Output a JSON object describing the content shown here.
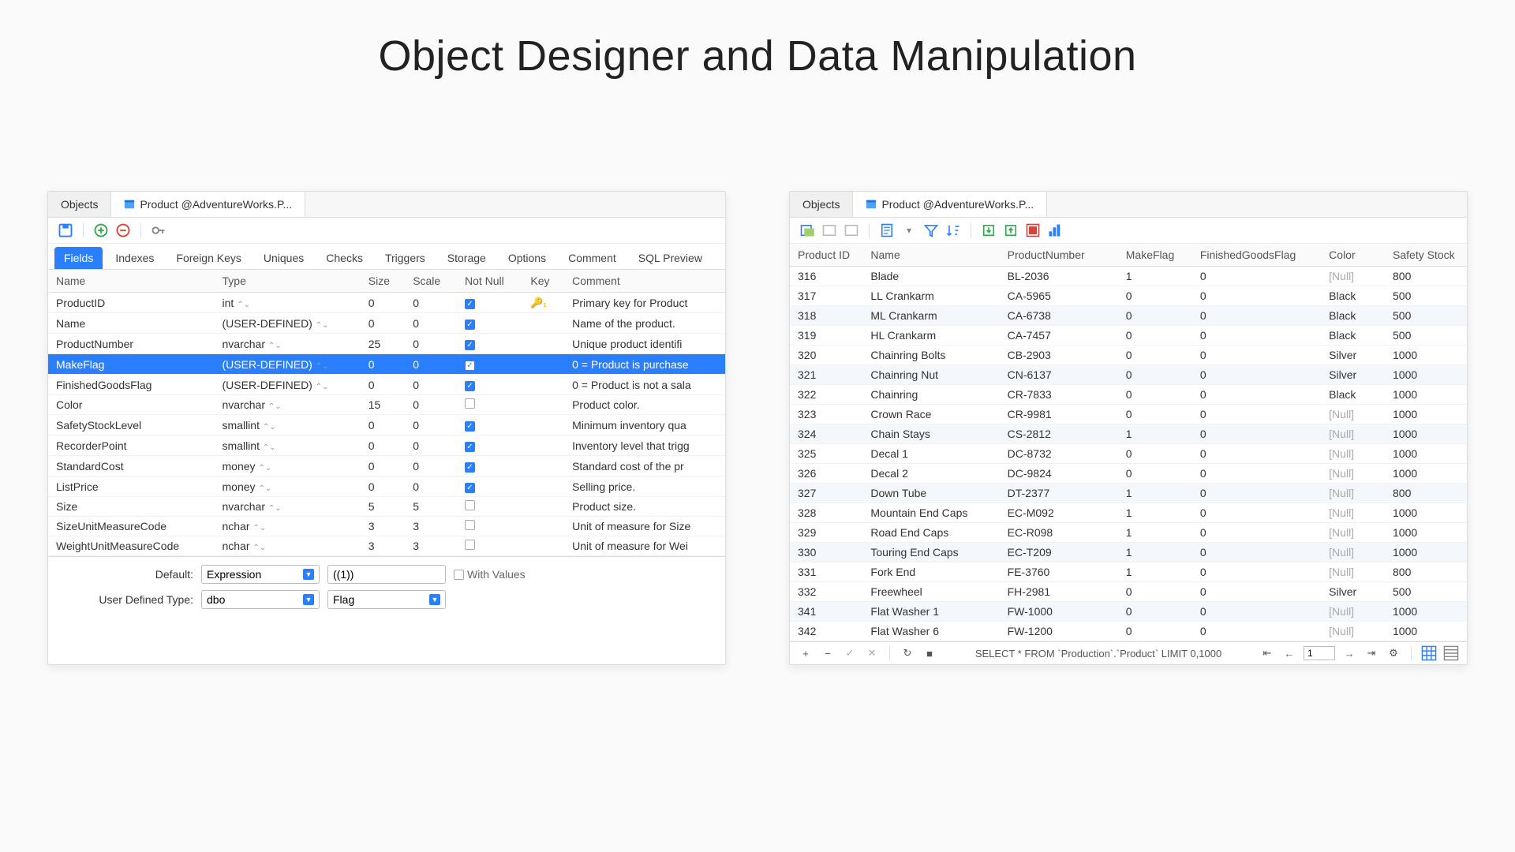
{
  "title": "Object Designer and Data Manipulation",
  "left": {
    "tabs": [
      "Objects",
      "Product @AdventureWorks.P..."
    ],
    "activeTab": 1,
    "subtabs": [
      "Fields",
      "Indexes",
      "Foreign Keys",
      "Uniques",
      "Checks",
      "Triggers",
      "Storage",
      "Options",
      "Comment",
      "SQL Preview"
    ],
    "activeSubtab": 0,
    "headers": [
      "Name",
      "Type",
      "Size",
      "Scale",
      "Not Null",
      "Key",
      "Comment"
    ],
    "rows": [
      {
        "name": "ProductID",
        "type": "int",
        "size": "0",
        "scale": "0",
        "nn": true,
        "key": true,
        "comment": "Primary key for Product"
      },
      {
        "name": "Name",
        "type": "(USER-DEFINED)",
        "size": "0",
        "scale": "0",
        "nn": true,
        "key": false,
        "comment": "Name of the product."
      },
      {
        "name": "ProductNumber",
        "type": "nvarchar",
        "size": "25",
        "scale": "0",
        "nn": true,
        "key": false,
        "comment": "Unique product identifi"
      },
      {
        "name": "MakeFlag",
        "type": "(USER-DEFINED)",
        "size": "0",
        "scale": "0",
        "nn": true,
        "key": false,
        "comment": "0 = Product is purchase",
        "sel": true
      },
      {
        "name": "FinishedGoodsFlag",
        "type": "(USER-DEFINED)",
        "size": "0",
        "scale": "0",
        "nn": true,
        "key": false,
        "comment": "0 = Product is not a sala"
      },
      {
        "name": "Color",
        "type": "nvarchar",
        "size": "15",
        "scale": "0",
        "nn": false,
        "key": false,
        "comment": "Product color."
      },
      {
        "name": "SafetyStockLevel",
        "type": "smallint",
        "size": "0",
        "scale": "0",
        "nn": true,
        "key": false,
        "comment": "Minimum inventory qua"
      },
      {
        "name": "RecorderPoint",
        "type": "smallint",
        "size": "0",
        "scale": "0",
        "nn": true,
        "key": false,
        "comment": "Inventory level that trigg"
      },
      {
        "name": "StandardCost",
        "type": "money",
        "size": "0",
        "scale": "0",
        "nn": true,
        "key": false,
        "comment": "Standard cost of the pr"
      },
      {
        "name": "ListPrice",
        "type": "money",
        "size": "0",
        "scale": "0",
        "nn": true,
        "key": false,
        "comment": "Selling price."
      },
      {
        "name": "Size",
        "type": "nvarchar",
        "size": "5",
        "scale": "5",
        "nn": false,
        "key": false,
        "comment": "Product size."
      },
      {
        "name": "SizeUnitMeasureCode",
        "type": "nchar",
        "size": "3",
        "scale": "3",
        "nn": false,
        "key": false,
        "comment": "Unit of measure for Size"
      },
      {
        "name": "WeightUnitMeasureCode",
        "type": "nchar",
        "size": "3",
        "scale": "3",
        "nn": false,
        "key": false,
        "comment": "Unit of measure for Wei"
      }
    ],
    "form": {
      "defaultLabel": "Default:",
      "defaultCombo": "Expression",
      "defaultValue": "((1))",
      "withValues": "With Values",
      "udtLabel": "User Defined Type:",
      "udtSchema": "dbo",
      "udtName": "Flag"
    }
  },
  "right": {
    "tabs": [
      "Objects",
      "Product @AdventureWorks.P..."
    ],
    "activeTab": 1,
    "headers": [
      "Product ID",
      "Name",
      "ProductNumber",
      "MakeFlag",
      "FinishedGoodsFlag",
      "Color",
      "Safety Stock"
    ],
    "rows": [
      {
        "id": "316",
        "name": "Blade",
        "pn": "BL-2036",
        "mf": "1",
        "fg": "0",
        "color": "[Null]",
        "ss": "800"
      },
      {
        "id": "317",
        "name": "LL Crankarm",
        "pn": "CA-5965",
        "mf": "0",
        "fg": "0",
        "color": "Black",
        "ss": "500"
      },
      {
        "id": "318",
        "name": "ML Crankarm",
        "pn": "CA-6738",
        "mf": "0",
        "fg": "0",
        "color": "Black",
        "ss": "500",
        "alt": true
      },
      {
        "id": "319",
        "name": "HL Crankarm",
        "pn": "CA-7457",
        "mf": "0",
        "fg": "0",
        "color": "Black",
        "ss": "500"
      },
      {
        "id": "320",
        "name": "Chainring Bolts",
        "pn": "CB-2903",
        "mf": "0",
        "fg": "0",
        "color": "Silver",
        "ss": "1000"
      },
      {
        "id": "321",
        "name": "Chainring Nut",
        "pn": "CN-6137",
        "mf": "0",
        "fg": "0",
        "color": "Silver",
        "ss": "1000",
        "alt": true
      },
      {
        "id": "322",
        "name": "Chainring",
        "pn": "CR-7833",
        "mf": "0",
        "fg": "0",
        "color": "Black",
        "ss": "1000"
      },
      {
        "id": "323",
        "name": "Crown Race",
        "pn": "CR-9981",
        "mf": "0",
        "fg": "0",
        "color": "[Null]",
        "ss": "1000"
      },
      {
        "id": "324",
        "name": "Chain Stays",
        "pn": "CS-2812",
        "mf": "1",
        "fg": "0",
        "color": "[Null]",
        "ss": "1000",
        "alt": true
      },
      {
        "id": "325",
        "name": "Decal 1",
        "pn": "DC-8732",
        "mf": "0",
        "fg": "0",
        "color": "[Null]",
        "ss": "1000"
      },
      {
        "id": "326",
        "name": "Decal 2",
        "pn": "DC-9824",
        "mf": "0",
        "fg": "0",
        "color": "[Null]",
        "ss": "1000"
      },
      {
        "id": "327",
        "name": "Down Tube",
        "pn": "DT-2377",
        "mf": "1",
        "fg": "0",
        "color": "[Null]",
        "ss": "800",
        "alt": true
      },
      {
        "id": "328",
        "name": "Mountain End Caps",
        "pn": "EC-M092",
        "mf": "1",
        "fg": "0",
        "color": "[Null]",
        "ss": "1000"
      },
      {
        "id": "329",
        "name": "Road End Caps",
        "pn": "EC-R098",
        "mf": "1",
        "fg": "0",
        "color": "[Null]",
        "ss": "1000"
      },
      {
        "id": "330",
        "name": "Touring End Caps",
        "pn": "EC-T209",
        "mf": "1",
        "fg": "0",
        "color": "[Null]",
        "ss": "1000",
        "alt": true
      },
      {
        "id": "331",
        "name": "Fork End",
        "pn": "FE-3760",
        "mf": "1",
        "fg": "0",
        "color": "[Null]",
        "ss": "800"
      },
      {
        "id": "332",
        "name": "Freewheel",
        "pn": "FH-2981",
        "mf": "0",
        "fg": "0",
        "color": "Silver",
        "ss": "500"
      },
      {
        "id": "341",
        "name": "Flat Washer 1",
        "pn": "FW-1000",
        "mf": "0",
        "fg": "0",
        "color": "[Null]",
        "ss": "1000",
        "alt": true
      },
      {
        "id": "342",
        "name": "Flat Washer 6",
        "pn": "FW-1200",
        "mf": "0",
        "fg": "0",
        "color": "[Null]",
        "ss": "1000"
      }
    ],
    "status": {
      "sql": "SELECT * FROM `Production`.`Product` LIMIT 0,1000",
      "page": "1"
    }
  }
}
